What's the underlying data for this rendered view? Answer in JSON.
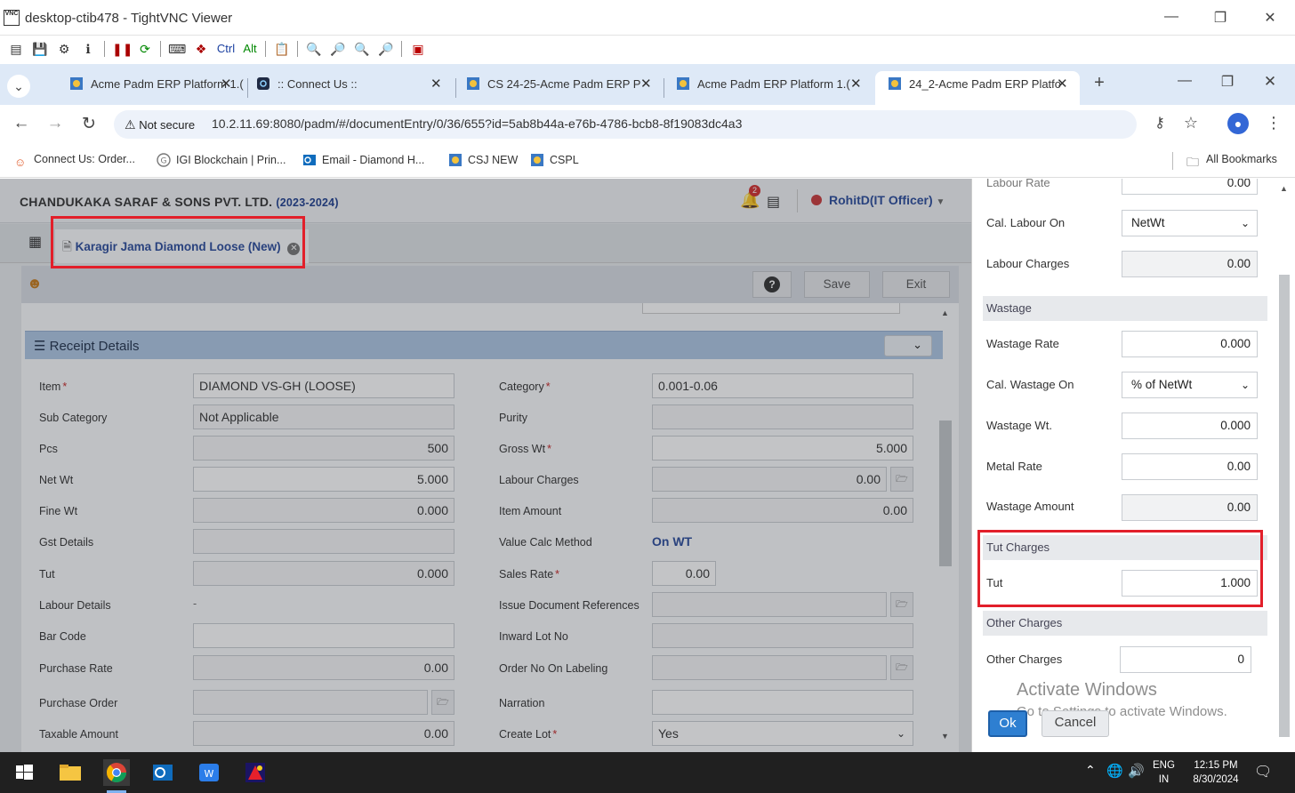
{
  "window": {
    "title": "desktop-ctib478 - TightVNC Viewer",
    "logo_text": "VNC"
  },
  "vnc_toolbar": {
    "labels": {
      "ctrl": "Ctrl",
      "alt": "Alt"
    }
  },
  "browser": {
    "tabs": [
      {
        "label": "Acme Padm ERP Platform 1.(",
        "icon": "erp-icon"
      },
      {
        "label": ":: Connect Us ::",
        "icon": "connect-icon"
      },
      {
        "label": "CS 24-25-Acme Padm ERP P",
        "icon": "erp-icon"
      },
      {
        "label": "Acme Padm ERP Platform 1.(",
        "icon": "erp-icon"
      },
      {
        "label": "24_2-Acme Padm ERP Platfo",
        "icon": "erp-icon",
        "active": true
      }
    ],
    "security_label": "Not secure",
    "url": "10.2.11.69:8080/padm/#/documentEntry/0/36/655?id=5ab8b44a-e76b-4786-bcb8-8f19083dc4a3",
    "bookmarks": [
      {
        "label": "Connect Us: Order..."
      },
      {
        "label": "IGI Blockchain | Prin..."
      },
      {
        "label": "Email - Diamond H..."
      },
      {
        "label": "CSJ NEW"
      },
      {
        "label": "CSPL"
      }
    ],
    "all_bookmarks": "All Bookmarks"
  },
  "app": {
    "company": "CHANDUKAKA SARAF & SONS PVT. LTD.",
    "year": "(2023-2024)",
    "notification_count": "2",
    "user": "RohitD(IT Officer)",
    "doc_tab": "Karagir Jama Diamond Loose (New)",
    "toolbar": {
      "help": "?",
      "save": "Save",
      "exit": "Exit"
    },
    "section_title": "Receipt Details",
    "left_fields": [
      {
        "label": "Item",
        "required": "*",
        "value": "DIAMOND VS-GH (LOOSE)"
      },
      {
        "label": "Sub Category",
        "value": "Not Applicable"
      },
      {
        "label": "Pcs",
        "value": "500"
      },
      {
        "label": "Net Wt",
        "value": "5.000"
      },
      {
        "label": "Fine Wt",
        "value": "0.000"
      },
      {
        "label": "Gst Details",
        "value": ""
      },
      {
        "label": "Tut",
        "value": "0.000"
      },
      {
        "label": "Labour Details",
        "value": "-"
      },
      {
        "label": "Bar Code",
        "value": ""
      },
      {
        "label": "Purchase Rate",
        "value": "0.00"
      },
      {
        "label": "Purchase Order",
        "value": ""
      },
      {
        "label": "Taxable Amount",
        "value": "0.00"
      }
    ],
    "right_fields": [
      {
        "label": "Category",
        "required": "*",
        "value": "0.001-0.06"
      },
      {
        "label": "Purity",
        "value": ""
      },
      {
        "label": "Gross Wt",
        "required": "*",
        "value": "5.000"
      },
      {
        "label": "Labour Charges",
        "value": "0.00"
      },
      {
        "label": "Item Amount",
        "value": "0.00"
      },
      {
        "label": "Value Calc Method",
        "value": "On WT"
      },
      {
        "label": "Sales Rate",
        "required": "*",
        "value": "0.00"
      },
      {
        "label": "Issue Document References",
        "value": ""
      },
      {
        "label": "Inward Lot No",
        "value": ""
      },
      {
        "label": "Order No On Labeling",
        "value": ""
      },
      {
        "label": "Narration",
        "value": ""
      },
      {
        "label": "Create Lot",
        "required": "*",
        "value": "Yes"
      }
    ]
  },
  "panel": {
    "labour_rate": {
      "label": "Labour Rate",
      "value": "0.00"
    },
    "cal_labour_on": {
      "label": "Cal. Labour On",
      "value": "NetWt"
    },
    "labour_charges": {
      "label": "Labour Charges",
      "value": "0.00"
    },
    "wastage_group": "Wastage",
    "wastage_rate": {
      "label": "Wastage Rate",
      "value": "0.000"
    },
    "cal_wastage_on": {
      "label": "Cal. Wastage On",
      "value": "% of NetWt"
    },
    "wastage_wt": {
      "label": "Wastage Wt.",
      "value": "0.000"
    },
    "metal_rate": {
      "label": "Metal Rate",
      "value": "0.00"
    },
    "wastage_amount": {
      "label": "Wastage Amount",
      "value": "0.00"
    },
    "tut_group": "Tut Charges",
    "tut": {
      "label": "Tut",
      "value": "1.000"
    },
    "other_group": "Other Charges",
    "other_charges": {
      "label": "Other Charges",
      "value": "0"
    },
    "ok": "Ok",
    "cancel": "Cancel",
    "watermark_title": "Activate Windows",
    "watermark_sub": "Go to Settings to activate Windows."
  },
  "taskbar": {
    "lang": "ENG",
    "region": "IN",
    "time": "12:15 PM",
    "date": "8/30/2024"
  },
  "colors": {
    "highlight_red": "#e21f2a",
    "brand_blue": "#2a4b9b",
    "section_blue": "#aec7e4"
  }
}
